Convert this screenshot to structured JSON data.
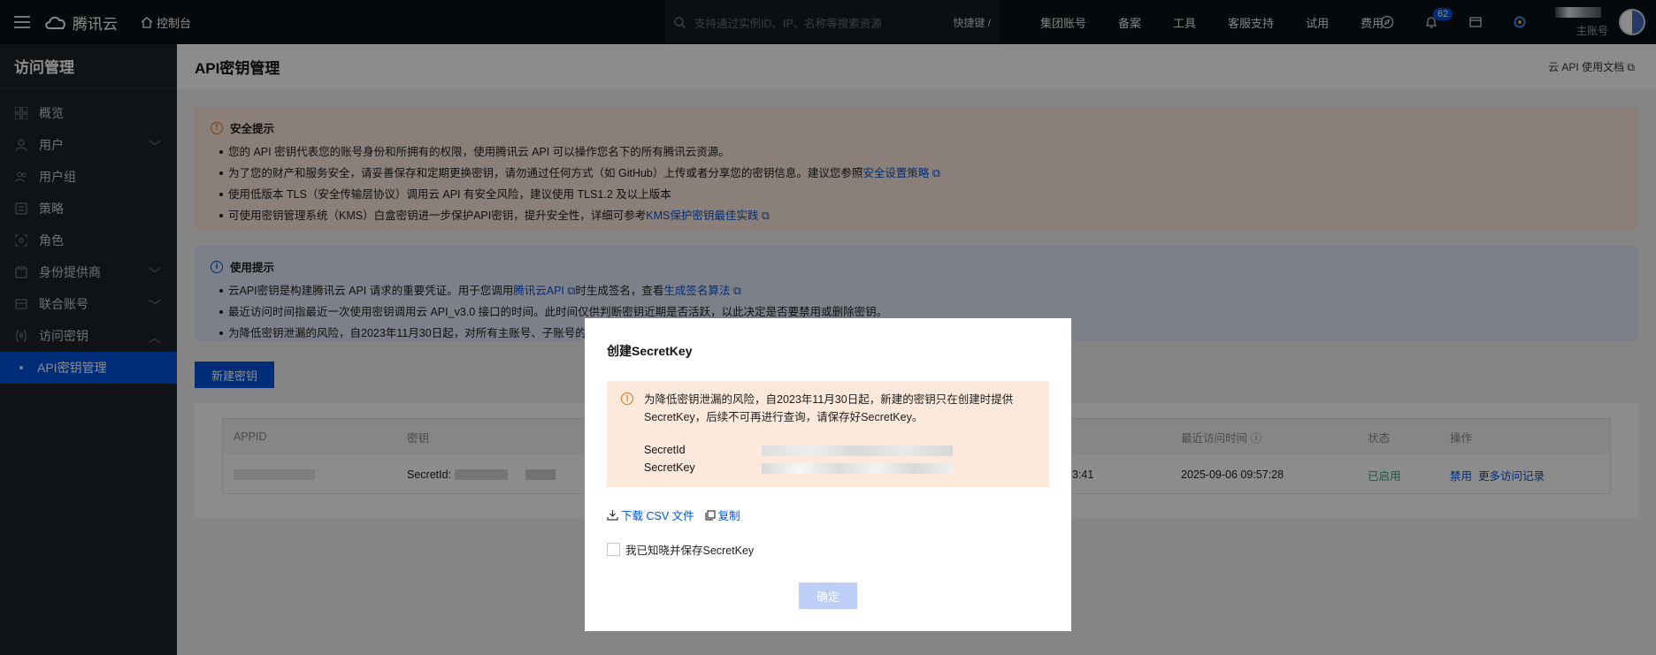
{
  "topbar": {
    "logo_text": "腾讯云",
    "console": "控制台",
    "search_placeholder": "支持通过实例ID、IP、名称等搜索资源",
    "shortcut": "快捷键 /",
    "links": [
      "集团账号",
      "备案",
      "工具",
      "客服支持",
      "试用",
      "费用"
    ],
    "notification_count": "62",
    "account_label": "主账号"
  },
  "sidebar": {
    "title": "访问管理",
    "items": [
      {
        "label": "概览",
        "icon": "grid-icon",
        "chevron": ""
      },
      {
        "label": "用户",
        "icon": "user-icon",
        "chevron": "﹀"
      },
      {
        "label": "用户组",
        "icon": "users-icon",
        "chevron": ""
      },
      {
        "label": "策略",
        "icon": "policy-icon",
        "chevron": ""
      },
      {
        "label": "角色",
        "icon": "role-icon",
        "chevron": ""
      },
      {
        "label": "身份提供商",
        "icon": "idp-icon",
        "chevron": "﹀"
      },
      {
        "label": "联合账号",
        "icon": "federated-icon",
        "chevron": "﹀"
      },
      {
        "label": "访问密钥",
        "icon": "key-icon",
        "chevron": "︿"
      }
    ],
    "active_item": "API密钥管理"
  },
  "page": {
    "title": "API密钥管理",
    "doc_link": "云 API 使用文档"
  },
  "security_tip": {
    "title": "安全提示",
    "items": [
      {
        "text": "您的 API 密钥代表您的账号身份和所拥有的权限，使用腾讯云 API 可以操作您名下的所有腾讯云资源。",
        "link": ""
      },
      {
        "text": "为了您的财产和服务安全，请妥善保存和定期更换密钥，请勿通过任何方式（如 GitHub）上传或者分享您的密钥信息。建议您参照",
        "link": "安全设置策略"
      },
      {
        "text": "使用低版本 TLS（安全传输层协议）调用云 API 有安全风险，建议使用 TLS1.2 及以上版本",
        "link": ""
      },
      {
        "text": "可使用密钥管理系统（KMS）白盒密钥进一步保护API密钥，提升安全性，详细可参考",
        "link": "KMS保护密钥最佳实践"
      }
    ]
  },
  "usage_tip": {
    "title": "使用提示",
    "item1_a": "云API密钥是构建腾讯云 API 请求的重要凭证。用于您调用",
    "item1_link1": "腾讯云API",
    "item1_b": "时生成签名，查看",
    "item1_link2": "生成签名算法",
    "item2": "最近访问时间指最近一次使用密钥调用云 API_v3.0 接口的时间。此时间仅供判断密钥近期是否活跃，以此决定是否要禁用或删除密钥。",
    "item3": "为降低密钥泄漏的风险，自2023年11月30日起，对所有主账号、子账号的"
  },
  "new_key_button": "新建密钥",
  "table": {
    "headers": {
      "appid": "APPID",
      "key": "密钥",
      "last_access": "最近访问时间",
      "status": "状态",
      "action": "操作"
    },
    "row": {
      "secret_id_label": "SecretId:",
      "created_time_tail": "3:41",
      "last_access": "2025-09-06 09:57:28",
      "status": "已启用",
      "action_disable": "禁用",
      "action_more": "更多访问记录"
    }
  },
  "modal": {
    "title": "创建SecretKey",
    "warning": "为降低密钥泄漏的风险，自2023年11月30日起，新建的密钥只在创建时提供SecretKey，后续不可再进行查询，请保存好SecretKey。",
    "secret_id_label": "SecretId",
    "secret_key_label": "SecretKey",
    "download_csv": "下载 CSV 文件",
    "copy": "复制",
    "ack_checkbox": "我已知晓并保存SecretKey",
    "ok_button": "确定"
  },
  "colors": {
    "primary": "#0052d9",
    "warning": "#e37318",
    "success": "#2ba471"
  }
}
